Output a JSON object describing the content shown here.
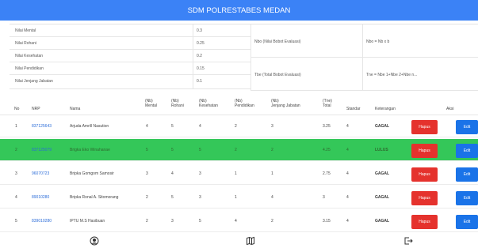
{
  "header": {
    "title": "SDM POLRESTABES MEDAN"
  },
  "weights": [
    {
      "label": "Nilai Mental",
      "value": "0.3"
    },
    {
      "label": "Nilai Rohani",
      "value": "0.25"
    },
    {
      "label": "Nilai Kesehatan",
      "value": "0.2"
    },
    {
      "label": "Nilai Pendidikan",
      "value": "0.15"
    },
    {
      "label": "Nilai Jenjang Jabatan",
      "value": "0.1"
    }
  ],
  "formulas": [
    {
      "label": "Nbo (Nilai Bobot Evaluasi)",
      "value": "Nbo = Nb x b"
    },
    {
      "label": "Tbe (Total Bobot Evaluasi)",
      "value": "Tne = Nbe 1+Nbe 2+Nbe n..."
    }
  ],
  "table": {
    "headers": {
      "no": "No",
      "nrp": "NRP",
      "nama": "Nama",
      "mental": [
        "(Nb)",
        "Mental"
      ],
      "rohani": [
        "(Nb)",
        "Rohani"
      ],
      "kesehatan": [
        "(Nb)",
        "Kesehatan"
      ],
      "pendidikan": [
        "(Nb)",
        "Pendidikan"
      ],
      "jabatan": [
        "(Nb)",
        "Jenjang Jabatan"
      ],
      "total": [
        "(Tne)",
        "Total"
      ],
      "standar": "Standar",
      "keterangan": "Keterangan",
      "aksi": "Aksi"
    },
    "rows": [
      {
        "no": "1",
        "nrp": "837125643",
        "nama": "Arjuda Amrill Nasution",
        "mental": "4",
        "rohani": "5",
        "kesehatan": "4",
        "pendidikan": "2",
        "jabatan": "3",
        "total": "3.25",
        "standar": "4",
        "keterangan": "GAGAL",
        "highlight": false
      },
      {
        "no": "2",
        "nrp": "837125079",
        "nama": "Brigka Eko Winahanae",
        "mental": "5",
        "rohani": "5",
        "kesehatan": "5",
        "pendidikan": "2",
        "jabatan": "2",
        "total": "4.25",
        "standar": "4",
        "keterangan": "LULUS",
        "highlight": true
      },
      {
        "no": "3",
        "nrp": "96070723",
        "nama": "Bripka Gomgom Samosir",
        "mental": "3",
        "rohani": "4",
        "kesehatan": "3",
        "pendidikan": "1",
        "jabatan": "1",
        "total": "2.75",
        "standar": "4",
        "keterangan": "GAGAL",
        "highlight": false
      },
      {
        "no": "4",
        "nrp": "89010280",
        "nama": "Bripka Ronal A. Sitomorang",
        "mental": "2",
        "rohani": "5",
        "kesehatan": "3",
        "pendidikan": "1",
        "jabatan": "4",
        "total": "3",
        "standar": "4",
        "keterangan": "GAGAL",
        "highlight": false
      },
      {
        "no": "5",
        "nrp": "839010280",
        "nama": "IPTU M.S Hasibuan",
        "mental": "2",
        "rohani": "3",
        "kesehatan": "5",
        "pendidikan": "4",
        "jabatan": "2",
        "total": "3.15",
        "standar": "4",
        "keterangan": "GAGAL",
        "highlight": false
      }
    ],
    "actions": {
      "delete": "Hapus",
      "edit": "Edit"
    }
  },
  "bottom_nav": [
    {
      "icon": "user-icon"
    },
    {
      "icon": "map-icon"
    },
    {
      "icon": "logout-icon"
    }
  ],
  "colors": {
    "header": "#3b82f6",
    "highlight_row": "#34c759",
    "hapus": "#e5322d",
    "edit": "#1a73e8",
    "nrp_link": "#2b6cd8"
  }
}
